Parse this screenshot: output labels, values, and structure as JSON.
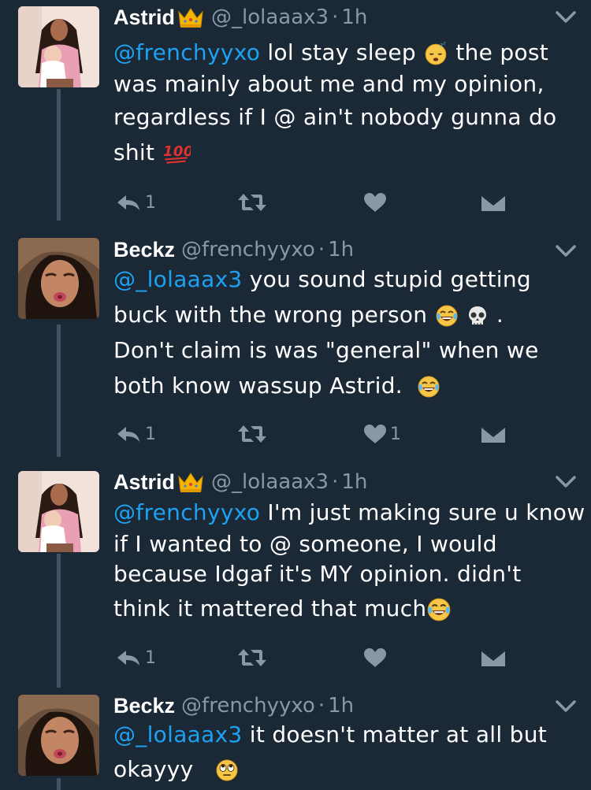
{
  "tweets": [
    {
      "name": "Astrid",
      "handle": "@_lolaaax3",
      "time": "1h",
      "lines": [
        {
          "mention": "@frenchyyxo",
          "text": " lol stay sleep",
          "emoji": "sleeping-face",
          "after": " the post"
        },
        {
          "text": "was mainly about me and my opinion,"
        },
        {
          "text": "regardless if I @ ain't nobody gunna do"
        },
        {
          "text": "shit",
          "emoji": "hundred-points"
        }
      ],
      "reply_count": "1",
      "like_count": ""
    },
    {
      "name": "Beckz",
      "handle": "@frenchyyxo",
      "time": "1h",
      "lines": [
        {
          "mention": "@_lolaaax3",
          "text": " you sound stupid getting"
        },
        {
          "text": "buck with the wrong person",
          "emoji": "tears-of-joy skull",
          "after": " ."
        },
        {
          "text": "Don't claim is was \"general\" when we"
        },
        {
          "text": "both know wassup Astrid.",
          "emoji": "tears-of-joy"
        }
      ],
      "reply_count": "1",
      "like_count": "1"
    },
    {
      "name": "Astrid",
      "handle": "@_lolaaax3",
      "time": "1h",
      "lines": [
        {
          "mention": "@frenchyyxo",
          "text": " I'm just making sure u know"
        },
        {
          "text": "if I wanted to @ someone, I would"
        },
        {
          "text": "because Idgaf it's MY opinion. didn't"
        },
        {
          "text": "think it mattered that much",
          "emoji": "tears-of-joy"
        }
      ],
      "reply_count": "1",
      "like_count": ""
    },
    {
      "name": "Beckz",
      "handle": "@frenchyyxo",
      "time": "1h",
      "lines": [
        {
          "mention": "@_lolaaax3",
          "text": " it doesn't matter at all but"
        },
        {
          "text": "okayyy",
          "emoji": "rolling-eyes"
        }
      ]
    }
  ],
  "separator": "·",
  "colors": {
    "background": "#1b2836",
    "link": "#1da1f2",
    "muted": "#8899a6"
  }
}
